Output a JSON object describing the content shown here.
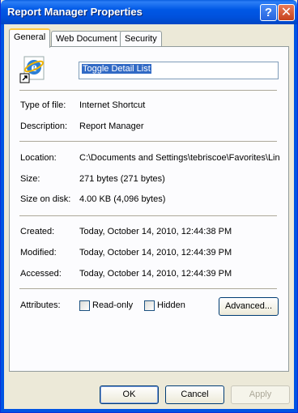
{
  "window": {
    "title": "Report Manager Properties",
    "help_glyph": "?",
    "close_glyph": "✕"
  },
  "tabs": [
    {
      "label": "General"
    },
    {
      "label": "Web Document"
    },
    {
      "label": "Security"
    }
  ],
  "file": {
    "name": "Toggle Detail List",
    "icon": "internet-explorer-shortcut-icon"
  },
  "fields": {
    "type_label": "Type of file:",
    "type_value": "Internet Shortcut",
    "desc_label": "Description:",
    "desc_value": "Report Manager",
    "location_label": "Location:",
    "location_value": "C:\\Documents and Settings\\tebriscoe\\Favorites\\Lin",
    "size_label": "Size:",
    "size_value": "271 bytes (271 bytes)",
    "disk_label": "Size on disk:",
    "disk_value": "4.00 KB (4,096 bytes)",
    "created_label": "Created:",
    "created_value": "Today, October 14, 2010, 12:44:38 PM",
    "modified_label": "Modified:",
    "modified_value": "Today, October 14, 2010, 12:44:39 PM",
    "accessed_label": "Accessed:",
    "accessed_value": "Today, October 14, 2010, 12:44:39 PM"
  },
  "attributes": {
    "label": "Attributes:",
    "readonly": "Read-only",
    "hidden": "Hidden",
    "advanced": "Advanced..."
  },
  "buttons": {
    "ok": "OK",
    "cancel": "Cancel",
    "apply": "Apply"
  }
}
